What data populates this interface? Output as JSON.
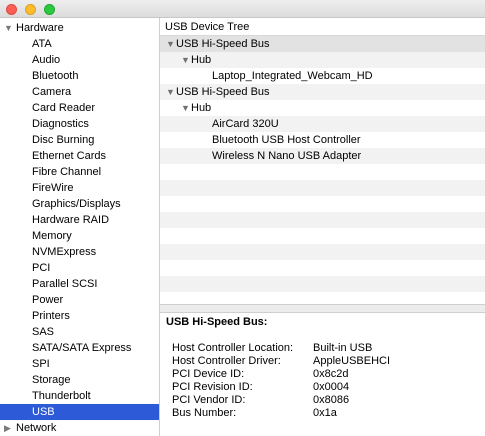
{
  "window": {
    "controls": [
      "close-button",
      "minimize-button",
      "zoom-button"
    ]
  },
  "sidebar": {
    "hardware_label": "Hardware",
    "items": [
      {
        "label": "ATA"
      },
      {
        "label": "Audio"
      },
      {
        "label": "Bluetooth"
      },
      {
        "label": "Camera"
      },
      {
        "label": "Card Reader"
      },
      {
        "label": "Diagnostics"
      },
      {
        "label": "Disc Burning"
      },
      {
        "label": "Ethernet Cards"
      },
      {
        "label": "Fibre Channel"
      },
      {
        "label": "FireWire"
      },
      {
        "label": "Graphics/Displays"
      },
      {
        "label": "Hardware RAID"
      },
      {
        "label": "Memory"
      },
      {
        "label": "NVMExpress"
      },
      {
        "label": "PCI"
      },
      {
        "label": "Parallel SCSI"
      },
      {
        "label": "Power"
      },
      {
        "label": "Printers"
      },
      {
        "label": "SAS"
      },
      {
        "label": "SATA/SATA Express"
      },
      {
        "label": "SPI"
      },
      {
        "label": "Storage"
      },
      {
        "label": "Thunderbolt"
      },
      {
        "label": "USB",
        "selected": true
      }
    ],
    "network_label": "Network",
    "selection_color": "#2d5ad7"
  },
  "tree": {
    "header": "USB Device Tree",
    "rows": [
      {
        "label": "USB Hi-Speed Bus",
        "level": 0,
        "expanded": true,
        "selected": true
      },
      {
        "label": "Hub",
        "level": 1,
        "expanded": true
      },
      {
        "label": "Laptop_Integrated_Webcam_HD",
        "level": 2
      },
      {
        "label": "USB Hi-Speed Bus",
        "level": 0,
        "expanded": true
      },
      {
        "label": "Hub",
        "level": 1,
        "expanded": true
      },
      {
        "label": "AirCard 320U",
        "level": 2
      },
      {
        "label": "Bluetooth USB Host Controller",
        "level": 2
      },
      {
        "label": "Wireless N Nano USB Adapter",
        "level": 2
      }
    ]
  },
  "detail": {
    "title": "USB Hi-Speed Bus:",
    "properties": [
      {
        "label": "Host Controller Location:",
        "value": "Built-in USB"
      },
      {
        "label": "Host Controller Driver:",
        "value": "AppleUSBEHCI"
      },
      {
        "label": "PCI Device ID:",
        "value": "0x8c2d"
      },
      {
        "label": "PCI Revision ID:",
        "value": "0x0004"
      },
      {
        "label": "PCI Vendor ID:",
        "value": "0x8086"
      },
      {
        "label": "Bus Number:",
        "value": "0x1a"
      }
    ]
  }
}
